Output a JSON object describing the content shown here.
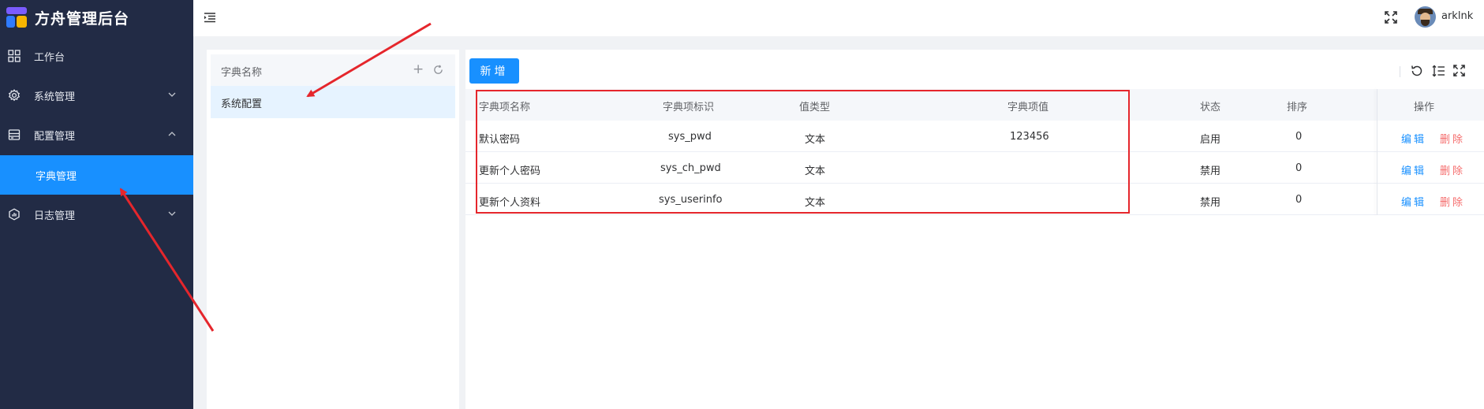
{
  "app": {
    "title": "方舟管理后台"
  },
  "sidebar": {
    "items": [
      {
        "label": "工作台",
        "icon": "grid-icon"
      },
      {
        "label": "系统管理",
        "icon": "gear-icon",
        "arrow": "chevron-down"
      },
      {
        "label": "配置管理",
        "icon": "config-icon",
        "arrow": "chevron-up"
      },
      {
        "label": "字典管理",
        "active": true
      },
      {
        "label": "日志管理",
        "icon": "log-icon",
        "arrow": "chevron-down"
      }
    ]
  },
  "header": {
    "username": "arklnk"
  },
  "dict_panel": {
    "header_label": "字典名称",
    "items": [
      {
        "label": "系统配置",
        "selected": true
      }
    ]
  },
  "table": {
    "add_label": "新增",
    "columns": [
      "字典项名称",
      "字典项标识",
      "值类型",
      "字典项值",
      "状态",
      "排序",
      "操作"
    ],
    "rows": [
      {
        "name": "默认密码",
        "key": "sys_pwd",
        "type": "文本",
        "value": "123456",
        "status": "启用",
        "order": "0",
        "edit": "编辑",
        "delete": "删除"
      },
      {
        "name": "更新个人密码",
        "key": "sys_ch_pwd",
        "type": "文本",
        "value": "",
        "status": "禁用",
        "order": "0",
        "edit": "编辑",
        "delete": "删除"
      },
      {
        "name": "更新个人资料",
        "key": "sys_userinfo",
        "type": "文本",
        "value": "",
        "status": "禁用",
        "order": "0",
        "edit": "编辑",
        "delete": "删除"
      }
    ]
  },
  "colors": {
    "sidebar_bg": "#222b45",
    "accent": "#1890ff",
    "danger": "#f56c6c",
    "annotation": "#e5262c"
  }
}
